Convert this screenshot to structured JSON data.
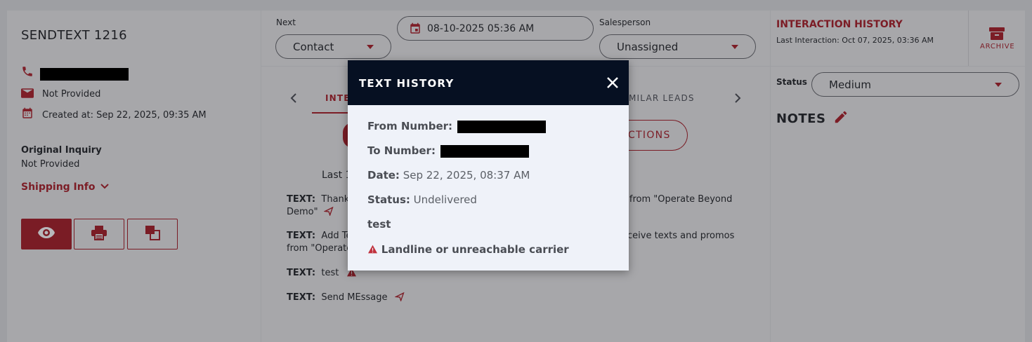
{
  "lead": {
    "title": "SENDTEXT 1216",
    "email": "Not Provided",
    "created": "Created at: Sep 22, 2025, 09:35 AM",
    "original_inquiry_label": "Original Inquiry",
    "original_inquiry_value": "Not Provided",
    "shipping_info": "Shipping Info"
  },
  "next": {
    "label": "Next",
    "value": "Contact"
  },
  "date": {
    "value": "08-10-2025 05:36 AM"
  },
  "salesperson": {
    "label": "Salesperson",
    "value": "Unassigned"
  },
  "tabs": {
    "left_partial": "INTE",
    "right_partial": "MILAR LEADS",
    "actions_partial": "CTIONS"
  },
  "messages": {
    "last_partial": "Last 1",
    "m1_label": "TEXT:",
    "m1_left": "Thanks",
    "m1_right": "s from \"Operate Beyond",
    "m1_line2": "Demo\"",
    "m2_label": "TEXT:",
    "m2_left": "Add Te",
    "m2_right": "eceive texts and promos",
    "m2_line2": "from \"Operate",
    "m3_label": "TEXT:",
    "m3_text": "test",
    "m4_label": "TEXT:",
    "m4_text": "Send MEssage"
  },
  "interaction_history": {
    "title": "INTERACTION HISTORY",
    "last": "Last Interaction: Oct 07, 2025, 03:36 AM",
    "archive": "ARCHIVE"
  },
  "status": {
    "label": "Status",
    "value": "Medium"
  },
  "notes": {
    "title": "NOTES"
  },
  "modal": {
    "title": "TEXT HISTORY",
    "from_label": "From Number:",
    "to_label": "To Number:",
    "date_label": "Date:",
    "date_value": "Sep 22, 2025, 08:37 AM",
    "status_label": "Status:",
    "status_value": "Undelivered",
    "message": "test",
    "warning": "Landline or unreachable carrier"
  },
  "colors": {
    "accent": "#c0313d",
    "header": "#061022",
    "modal_bg": "#eff2f9"
  }
}
